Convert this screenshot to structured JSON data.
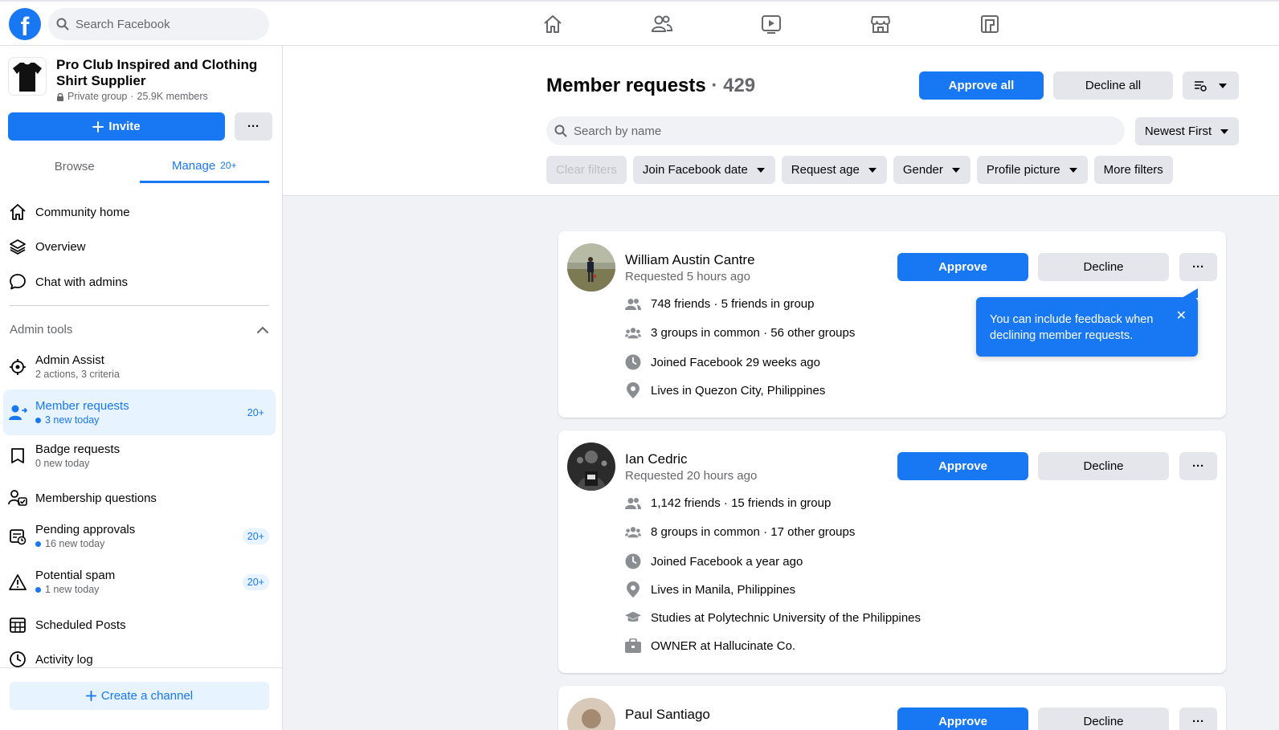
{
  "topbar": {
    "logo_letter": "f",
    "search_placeholder": "Search Facebook",
    "nav_icons": [
      "home-icon",
      "friends-icon",
      "watch-icon",
      "marketplace-icon",
      "groups-icon"
    ]
  },
  "group": {
    "name": "Pro Club Inspired and Clothing Shirt Supplier",
    "privacy": "Private group",
    "separator": "·",
    "members": "25.9K members",
    "invite_label": "Invite",
    "more_label": "···"
  },
  "side_tabs": {
    "browse": "Browse",
    "manage": "Manage",
    "manage_badge": "20+"
  },
  "menu": {
    "community_home": "Community home",
    "overview": "Overview",
    "chat_with_admins": "Chat with admins",
    "admin_tools_header": "Admin tools",
    "admin_assist": {
      "label": "Admin Assist",
      "sub": "2 actions, 3 criteria"
    },
    "member_requests": {
      "label": "Member requests",
      "sub": "3 new today",
      "badge": "20+"
    },
    "badge_requests": {
      "label": "Badge requests",
      "sub": "0 new today"
    },
    "membership_questions": {
      "label": "Membership questions"
    },
    "pending_approvals": {
      "label": "Pending approvals",
      "sub": "16 new today",
      "badge": "20+"
    },
    "potential_spam": {
      "label": "Potential spam",
      "sub": "1 new today",
      "badge": "20+"
    },
    "scheduled_posts": {
      "label": "Scheduled Posts"
    },
    "activity_log": {
      "label": "Activity log"
    },
    "create_channel": "Create a channel"
  },
  "header": {
    "title": "Member requests",
    "dot": "·",
    "count": "429",
    "approve_all": "Approve all",
    "decline_all": "Decline all",
    "search_placeholder": "Search by name",
    "sort": "Newest First",
    "filters": {
      "clear": "Clear filters",
      "join_date": "Join Facebook date",
      "request_age": "Request age",
      "gender": "Gender",
      "profile_picture": "Profile picture",
      "more": "More filters"
    }
  },
  "buttons": {
    "approve": "Approve",
    "decline": "Decline",
    "more": "···"
  },
  "requests": [
    {
      "name": "William Austin Cantre",
      "time": "Requested 5 hours ago",
      "friends": "748 friends",
      "friends_in_group": "5 friends in group",
      "groups_common": "3 groups in common",
      "other_groups": "56 other groups",
      "joined": "Joined Facebook 29 weeks ago",
      "lives_prefix": "Lives in",
      "lives": "Quezon City, Philippines"
    },
    {
      "name": "Ian Cedric",
      "time": "Requested 20 hours ago",
      "friends": "1,142 friends",
      "friends_in_group": "15 friends in group",
      "groups_common": "8 groups in common",
      "other_groups": "17 other groups",
      "joined": "Joined Facebook a year ago",
      "lives_prefix": "Lives in",
      "lives": "Manila, Philippines",
      "studies_prefix": "Studies at",
      "studies": "Polytechnic University of the Philippines",
      "work_prefix": "OWNER at",
      "work": "Hallucinate Co."
    },
    {
      "name": "Paul Santiago"
    }
  ],
  "tooltip": {
    "text": "You can include feedback when declining member requests.",
    "close": "✕"
  }
}
